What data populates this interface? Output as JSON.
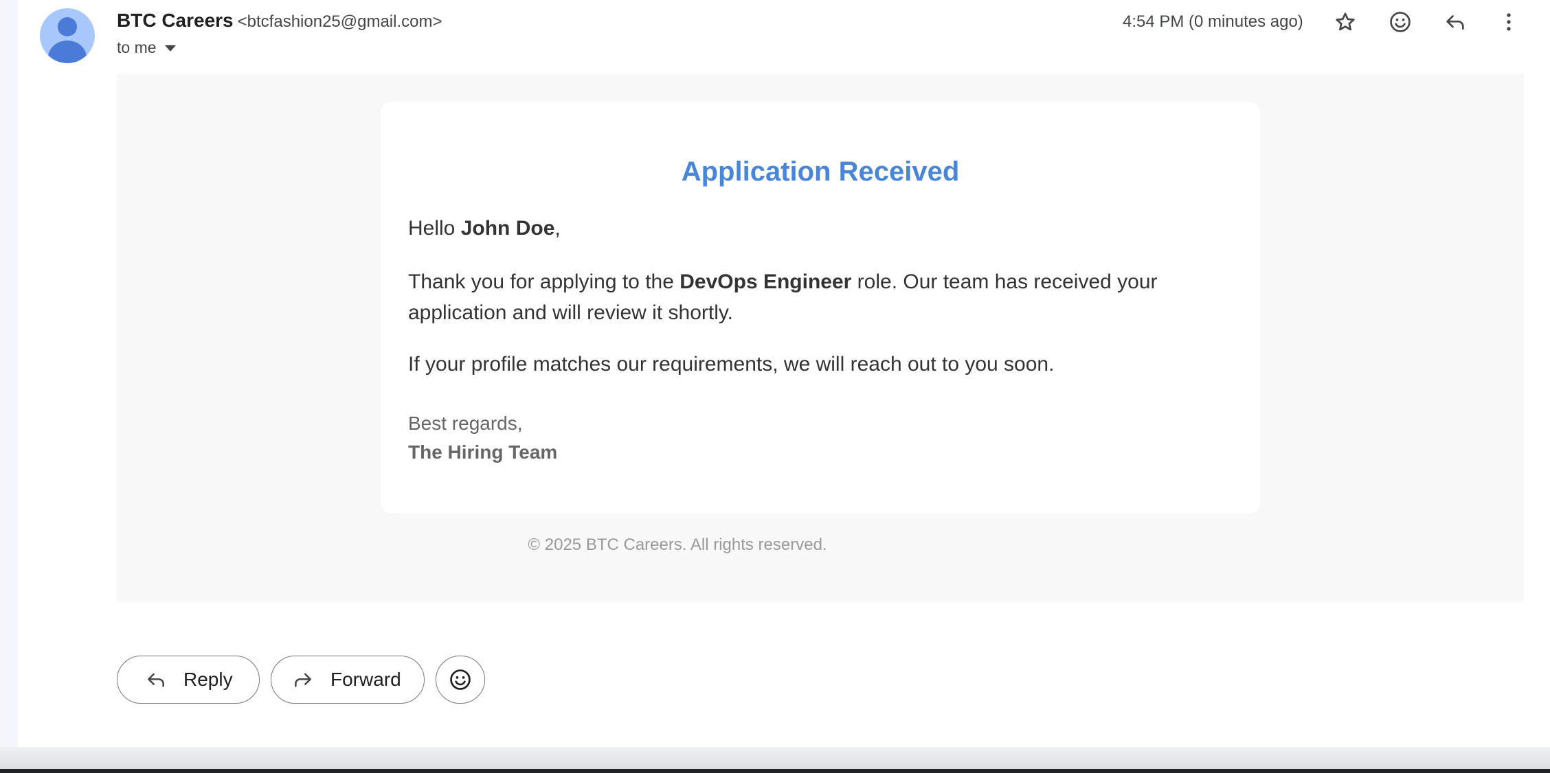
{
  "header": {
    "sender_name": "BTC Careers",
    "sender_email": "<btcfashion25@gmail.com>",
    "recipients": "to me",
    "timestamp": "4:54 PM (0 minutes ago)",
    "icons": [
      "star-icon",
      "emoji-reaction-icon",
      "reply-icon",
      "more-vert-icon"
    ]
  },
  "email": {
    "title": "Application Received",
    "greeting_prefix": "Hello ",
    "recipient_name": "John Doe",
    "greeting_suffix": ",",
    "p1_prefix": "Thank you for applying to the ",
    "role": "DevOps Engineer",
    "p1_suffix": " role. Our team has received your application and will review it shortly.",
    "p2": "If your profile matches our requirements, we will reach out to you soon.",
    "signoff": "Best regards,",
    "team": "The Hiring Team",
    "footer": "© 2025 BTC Careers. All rights reserved."
  },
  "actions": {
    "reply": "Reply",
    "forward": "Forward"
  },
  "colors": {
    "title_accent": "#4a86d8",
    "avatar_bg": "#a8c7fa",
    "avatar_fg": "#4a7bd9"
  }
}
